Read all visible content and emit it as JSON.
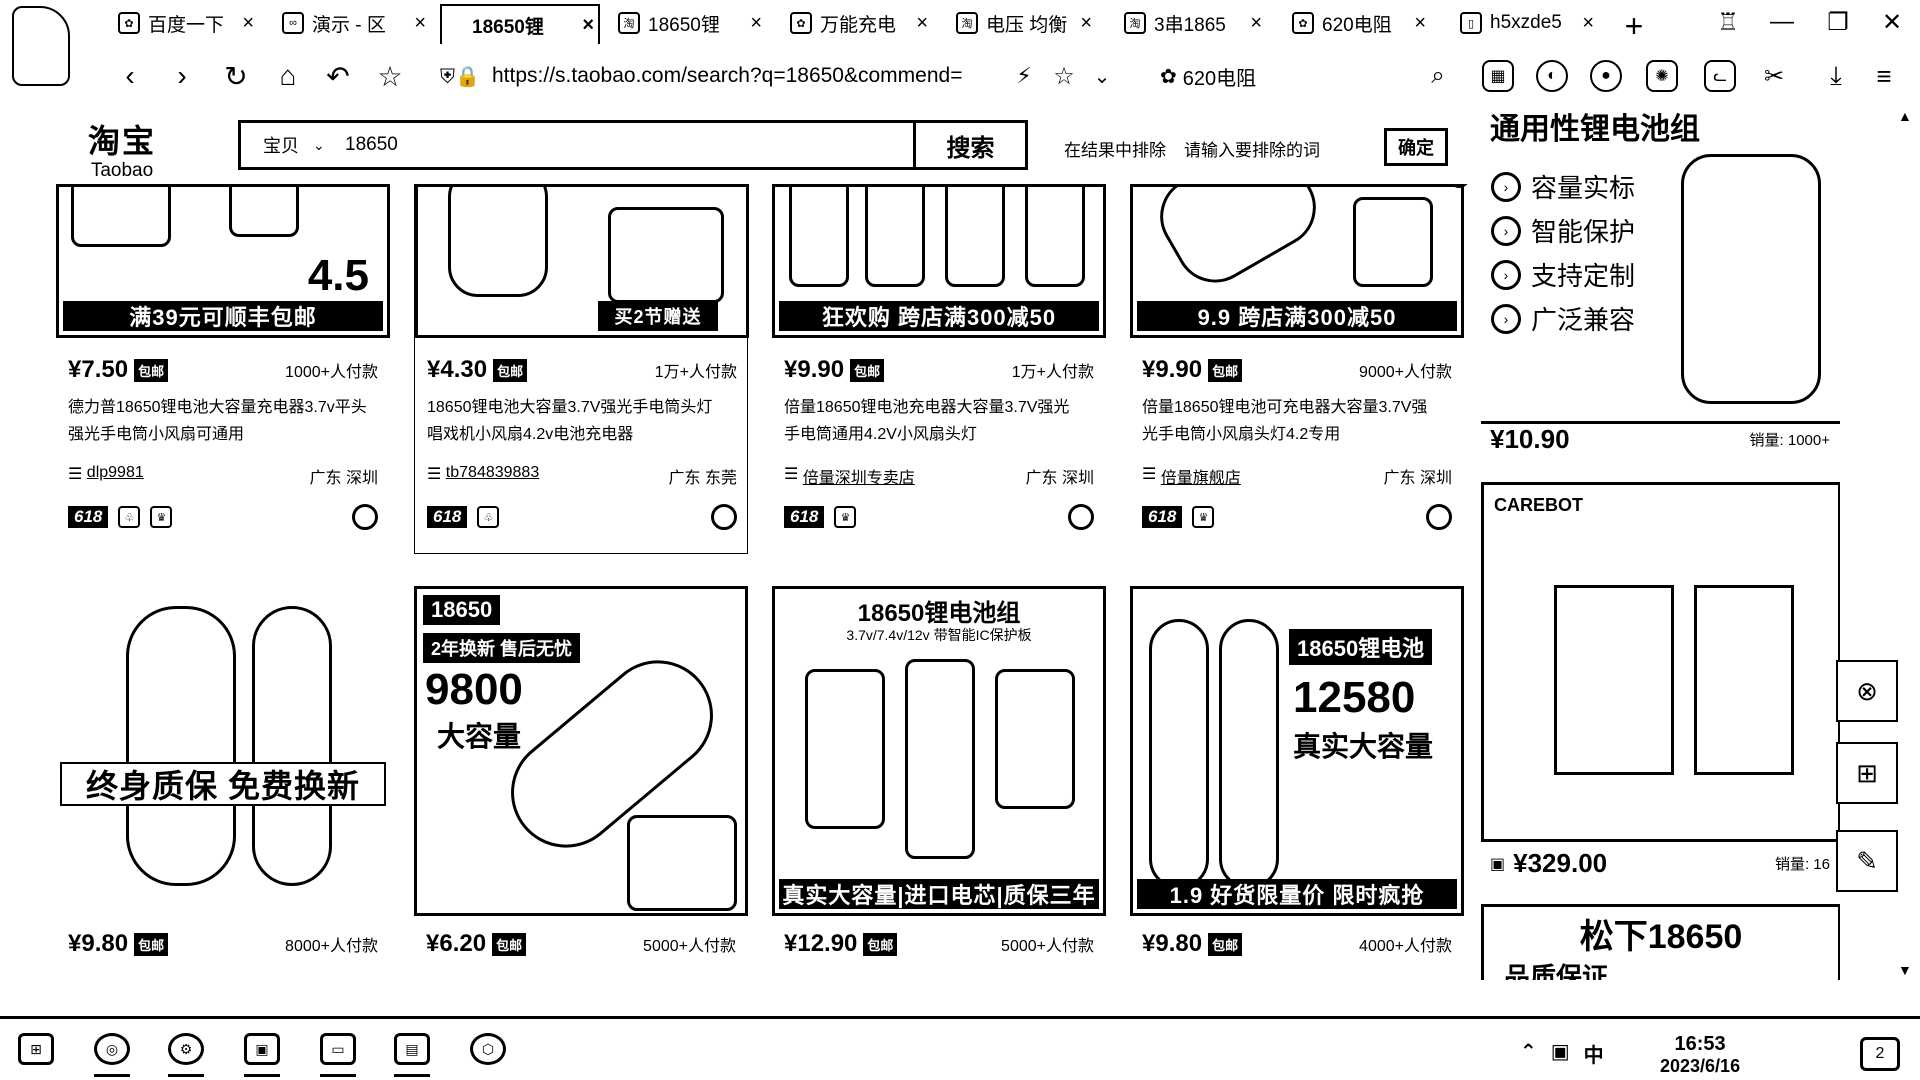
{
  "browser": {
    "tabs": [
      {
        "label": "百度一下",
        "icon": "paw-icon"
      },
      {
        "label": "演示 - 区",
        "icon": "link-icon"
      },
      {
        "label": "18650锂",
        "icon": "taobao-icon",
        "active": true
      },
      {
        "label": "18650锂",
        "icon": "taobao-icon"
      },
      {
        "label": "万能充电",
        "icon": "paw-icon"
      },
      {
        "label": "电压 均衡",
        "icon": "taobao-icon"
      },
      {
        "label": "3串1865",
        "icon": "taobao-icon"
      },
      {
        "label": "620电阻",
        "icon": "paw-icon"
      },
      {
        "label": "h5xzde5",
        "icon": "doc-icon"
      }
    ],
    "url": "https://s.taobao.com/search?q=18650&commend=",
    "side_search": "620电阻"
  },
  "taobao": {
    "logo_cn": "淘宝",
    "logo_en": "Taobao",
    "search_scope": "宝贝",
    "search_query": "18650",
    "search_button": "搜索",
    "exclude_label": "在结果中排除",
    "exclude_placeholder": "请输入要排除的词",
    "confirm_button": "确定"
  },
  "products": [
    {
      "banner": "满39元可顺丰包邮",
      "price": "¥7.50",
      "pkg": "包邮",
      "sold": "1000+人付款",
      "title": "德力普18650锂电池大容量充电器3.7v平头强光手电筒小风扇可通用",
      "shop": "dlp9981",
      "location": "广东 深圳",
      "tag": "618"
    },
    {
      "banner": "买2节赠送",
      "price": "¥4.30",
      "pkg": "包邮",
      "sold": "1万+人付款",
      "title": "18650锂电池大容量3.7V强光手电筒头灯唱戏机小风扇4.2v电池充电器",
      "shop": "tb784839883",
      "location": "广东 东莞",
      "tag": "618"
    },
    {
      "banner": "狂欢购 跨店满300减50",
      "price": "¥9.90",
      "pkg": "包邮",
      "sold": "1万+人付款",
      "title": "倍量18650锂电池充电器大容量3.7V强光手电筒通用4.2V小风扇头灯",
      "shop": "倍量深圳专卖店",
      "location": "广东 深圳",
      "tag": "618"
    },
    {
      "banner": "9.9 跨店满300减50",
      "price": "¥9.90",
      "pkg": "包邮",
      "sold": "9000+人付款",
      "title": "倍量18650锂电池可充电器大容量3.7V强光手电筒小风扇头灯4.2专用",
      "shop": "倍量旗舰店",
      "location": "广东 深圳",
      "tag": "618"
    },
    {
      "banner": "终身质保 免费换新",
      "price": "¥9.80",
      "pkg": "包邮",
      "sold": "8000+人付款"
    },
    {
      "banner": "2年换新 售后无忧",
      "big": "9800",
      "big_sub": "大容量",
      "top": "18650",
      "price": "¥6.20",
      "pkg": "包邮",
      "sold": "5000+人付款"
    },
    {
      "top": "18650锂电池组",
      "sub": "3.7v/7.4v/12v 带智能IC保护板",
      "banner": "真实大容量|进口电芯|质保三年",
      "price": "¥12.90",
      "pkg": "包邮",
      "sold": "5000+人付款"
    },
    {
      "top": "18650锂电池",
      "big": "12580",
      "big_sub": "真实大容量",
      "banner": "1.9 好货限量价 限时疯抢",
      "price": "¥9.80",
      "pkg": "包邮",
      "sold": "4000+人付款"
    }
  ],
  "ads": [
    {
      "headline": "通用性锂电池组",
      "features": [
        "容量实标",
        "智能保护",
        "支持定制",
        "广泛兼容"
      ],
      "price": "¥10.90",
      "sales": "销量: 1000+"
    },
    {
      "brand": "CAREBOT",
      "price": "¥329.00",
      "sales": "销量: 16"
    },
    {
      "headline": "松下18650",
      "sub": "品质保证"
    }
  ],
  "taskbar": {
    "time": "16:53",
    "date": "2023/6/16",
    "ime": "中"
  }
}
